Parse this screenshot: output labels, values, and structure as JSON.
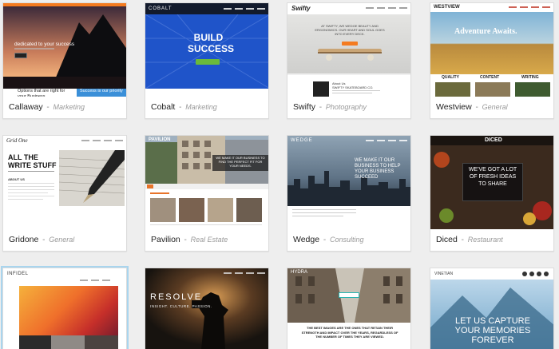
{
  "themes": [
    {
      "name": "Callaway",
      "category": "Marketing",
      "logo": "callaway",
      "tagline": "dedicated to your success",
      "band_left": "Options that are right for your Business",
      "band_right": "Success is our priority"
    },
    {
      "name": "Cobalt",
      "category": "Marketing",
      "logo": "COBALT",
      "headline": "BUILD SUCCESS"
    },
    {
      "name": "Swifty",
      "category": "Photography",
      "logo": "Swifty",
      "headline": "AT SWIFTY, WE WEDGE BEAUTY AND ERGONOMICS. OUR HEART AND SOUL GOES INTO EVERY DECK.",
      "sub_title": "About Us",
      "sub_line": "SWIFTY SKATEBOARD CO."
    },
    {
      "name": "Westview",
      "category": "General",
      "logo": "WESTVIEW",
      "headline": "Adventure Awaits.",
      "features": [
        "QUALITY",
        "CONTENT",
        "WRITING"
      ]
    },
    {
      "name": "Gridone",
      "category": "General",
      "logo": "Grid One",
      "headline": "ALL THE WRITE STUFF",
      "sub": "ABOUT US"
    },
    {
      "name": "Pavilion",
      "category": "Real Estate",
      "logo": "PAVILION",
      "headline": "WE MAKE IT OUR BUSINESS TO FIND THE PERFECT FIT FOR YOUR NEEDS."
    },
    {
      "name": "Wedge",
      "category": "Consulting",
      "logo": "WEDGE",
      "headline": "WE MAKE IT OUR BUSINESS TO HELP YOUR BUSINESS SUCCEED"
    },
    {
      "name": "Diced",
      "category": "Restaurant",
      "logo": "DICED",
      "headline": "WE'VE GOT A LOT OF FRESH IDEAS TO SHARE"
    },
    {
      "name": "",
      "category": "",
      "logo": "INFIDEL"
    },
    {
      "name": "",
      "category": "",
      "logo": "RESOLVE",
      "headline": "RESOLVE",
      "sub": "INSIGHT. CULTURE. PASSION."
    },
    {
      "name": "",
      "category": "",
      "logo": "HYDRA",
      "headline": "THE BEST IMAGES ARE THE ONES THAT RETAIN THEIR STRENGTH AND IMPACT OVER THE YEARS, REGARDLESS OF THE NUMBER OF TIMES THEY ARE VIEWED."
    },
    {
      "name": "",
      "category": "",
      "logo": "VINETIAN",
      "headline": "LET US CAPTURE YOUR MEMORIES FOREVER"
    }
  ],
  "colors": {
    "callaway_bar": "#f47b20",
    "cobalt_bg": "#1f54c9",
    "cobalt_btn": "#6aba3a",
    "westview_bar": "#3a4a2c"
  },
  "icons": [
    "callaway-mountain",
    "cobalt-grid",
    "skateboard",
    "wheat-field",
    "fountain-pen",
    "building-street",
    "city-skyline",
    "fruit-bowl",
    "orange-gradient",
    "photographer-silhouette",
    "narrow-street",
    "mountain-sky"
  ]
}
